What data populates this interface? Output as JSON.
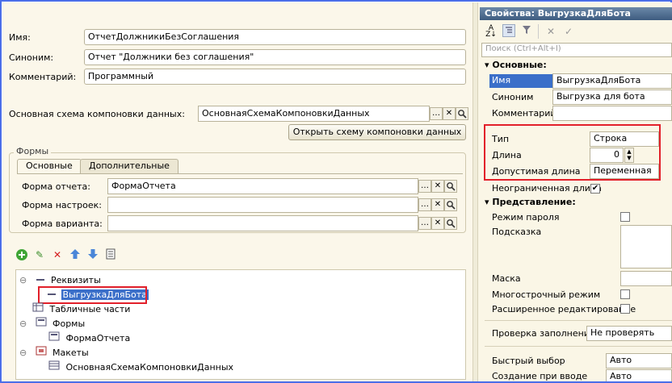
{
  "left": {
    "name_label": "Имя:",
    "name_value": "ОтчетДолжникиБезСоглашения",
    "synonym_label": "Синоним:",
    "synonym_value": "Отчет \"Должники без соглашения\"",
    "comment_label": "Комментарий:",
    "comment_value": "Программный",
    "schema_label": "Основная схема компоновки данных:",
    "schema_value": "ОсновнаяСхемаКомпоновкиДанных",
    "open_schema_button": "Открыть схему компоновки данных",
    "forms_group_title": "Формы",
    "tabs": [
      "Основные",
      "Дополнительные"
    ],
    "form_report_label": "Форма отчета:",
    "form_report_value": "ФормаОтчета",
    "form_settings_label": "Форма настроек:",
    "form_variant_label": "Форма варианта:",
    "tree": [
      {
        "label": "Реквизиты",
        "level": 0,
        "icon": "attributes-icon",
        "toggle": "⊖"
      },
      {
        "label": "ВыгрузкаДляБота",
        "level": 1,
        "icon": "attribute-icon",
        "toggle": ""
      },
      {
        "label": "Табличные части",
        "level": 0,
        "icon": "table-icon",
        "toggle": ""
      },
      {
        "label": "Формы",
        "level": 0,
        "icon": "forms-icon",
        "toggle": "⊖"
      },
      {
        "label": "ФормаОтчета",
        "level": 1,
        "icon": "form-icon",
        "toggle": ""
      },
      {
        "label": "Макеты",
        "level": 0,
        "icon": "templates-icon",
        "toggle": "⊖"
      },
      {
        "label": "ОсновнаяСхемаКомпоновкиДанных",
        "level": 1,
        "icon": "template-icon",
        "toggle": ""
      }
    ]
  },
  "right": {
    "title": "Свойства: ВыгрузкаДляБота",
    "search_placeholder": "Поиск (Ctrl+Alt+I)",
    "section_main": "Основные:",
    "name_label": "Имя",
    "name_value": "ВыгрузкаДляБота",
    "synonym_label": "Синоним",
    "synonym_value": "Выгрузка для бота",
    "comment_label": "Комментарий",
    "type_label": "Тип",
    "type_value": "Строка",
    "length_label": "Длина",
    "length_value": "0",
    "allowed_length_label": "Допустимая длина",
    "allowed_length_value": "Переменная",
    "unlimited_length_label": "Неограниченная длина",
    "unlimited_checked": "✔",
    "section_view": "Представление:",
    "password_mode_label": "Режим пароля",
    "hint_label": "Подсказка",
    "mask_label": "Маска",
    "multiline_label": "Многострочный режим",
    "extended_edit_label": "Расширенное редактирование",
    "fill_check_label": "Проверка заполнения",
    "fill_check_value": "Не проверять",
    "quick_choice_label": "Быстрый выбор",
    "quick_choice_value": "Авто",
    "create_on_input_label": "Создание при вводе",
    "create_on_input_value": "Авто"
  },
  "colors": {
    "accent": "#e2202a",
    "header": "#3e5c80",
    "selection": "#3b6fc9"
  }
}
